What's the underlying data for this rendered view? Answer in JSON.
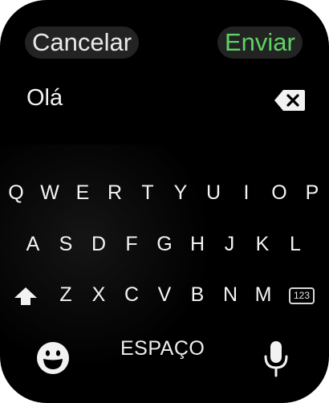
{
  "header": {
    "cancel_label": "Cancelar",
    "send_label": "Enviar"
  },
  "compose": {
    "text": "Olá"
  },
  "keyboard": {
    "row1": [
      "Q",
      "W",
      "E",
      "R",
      "T",
      "Y",
      "U",
      "I",
      "O",
      "P"
    ],
    "row2": [
      "A",
      "S",
      "D",
      "F",
      "G",
      "H",
      "J",
      "K",
      "L"
    ],
    "row3": [
      "Z",
      "X",
      "C",
      "V",
      "B",
      "N",
      "M"
    ],
    "numbers_label": "123",
    "space_label": "ESPAÇO"
  },
  "colors": {
    "background": "#000000",
    "send_accent": "#5bd462",
    "pill": "#232323"
  },
  "icons": [
    "backspace-icon",
    "shift-icon",
    "emoji-icon",
    "microphone-icon"
  ]
}
